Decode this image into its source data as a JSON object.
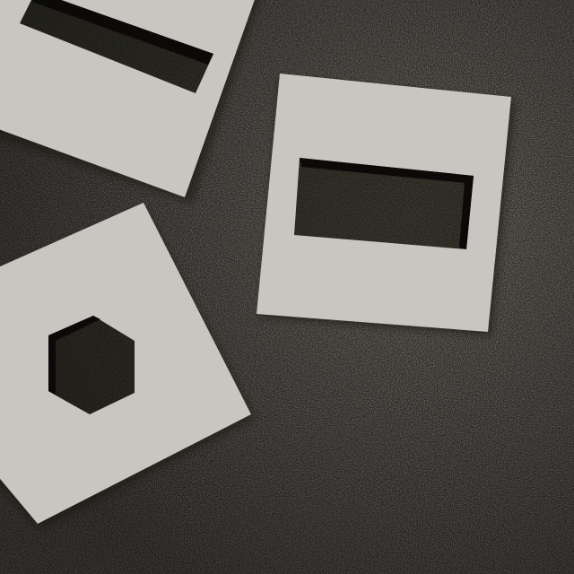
{
  "scene": {
    "description_free": true,
    "colors": {
      "surface": "#34322d",
      "surface_light": "#5a564e",
      "surface_dark": "#1c1b18",
      "card": "#c9c6c1",
      "card_shadow": "#141311",
      "hole_shadow": "#0b0a09"
    },
    "cards": [
      {
        "name": "card-top-left",
        "cutout_shape": "rectangle"
      },
      {
        "name": "card-top-right",
        "cutout_shape": "rectangle"
      },
      {
        "name": "card-bottom-left",
        "cutout_shape": "hexagon"
      }
    ]
  }
}
